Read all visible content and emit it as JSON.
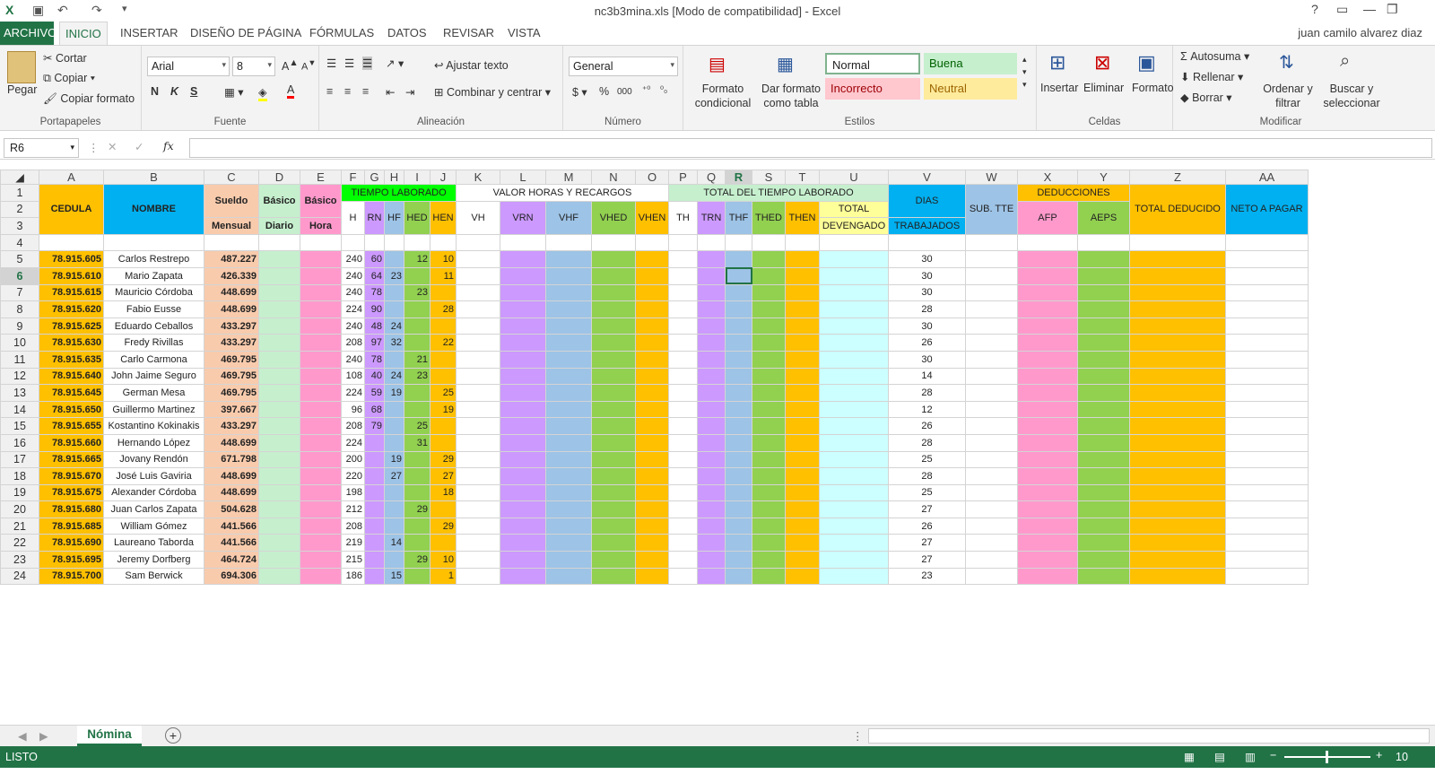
{
  "window": {
    "title": "nc3b3mina.xls  [Modo de compatibilidad] - Excel",
    "help": "?",
    "minimize": "—",
    "restore": "❐",
    "close": "✕"
  },
  "qat": {
    "save": "💾",
    "undo": "↶",
    "redo": "↷",
    "more": "⁼"
  },
  "tabs": [
    "ARCHIVO",
    "INICIO",
    "INSERTAR",
    "DISEÑO DE PÁGINA",
    "FÓRMULAS",
    "DATOS",
    "REVISAR",
    "VISTA"
  ],
  "user": "juan camilo alvarez diaz",
  "ribbon": {
    "clipboard": {
      "label": "Portapapeles",
      "paste": "Pegar",
      "cut": "Cortar",
      "copy": "Copiar",
      "format_painter": "Copiar formato"
    },
    "font": {
      "label": "Fuente",
      "name": "Arial",
      "size": "8",
      "bold": "N",
      "italic": "K",
      "underline": "S"
    },
    "alignment": {
      "label": "Alineación",
      "wrap": "Ajustar texto",
      "merge": "Combinar y centrar"
    },
    "number": {
      "label": "Número",
      "format": "General",
      "currency": "$",
      "percent": "%",
      "thousands": "000"
    },
    "styles": {
      "label": "Estilos",
      "conditional": "Formato condicional",
      "as_table": "Dar formato como tabla",
      "normal": "Normal",
      "good": "Buena",
      "bad": "Incorrecto",
      "neutral": "Neutral"
    },
    "cells": {
      "label": "Celdas",
      "insert": "Insertar",
      "delete": "Eliminar",
      "format": "Formato"
    },
    "editing": {
      "label": "Modificar",
      "autosum": "Autosuma",
      "fill": "Rellenar",
      "clear": "Borrar",
      "sort": "Ordenar y filtrar",
      "find": "Buscar y seleccionar"
    }
  },
  "formula_bar": {
    "name_box": "R6",
    "formula": "",
    "fx": "fx"
  },
  "sheet": {
    "columns": [
      "A",
      "B",
      "C",
      "D",
      "E",
      "F",
      "G",
      "H",
      "I",
      "J",
      "K",
      "L",
      "M",
      "N",
      "O",
      "P",
      "Q",
      "R",
      "S",
      "T",
      "U",
      "V",
      "W",
      "X",
      "Y",
      "Z",
      "AA"
    ],
    "header": {
      "cedula": "CEDULA",
      "nombre": "NOMBRE",
      "sueldo1": "Sueldo",
      "sueldo2": "Mensual",
      "basico_d1": "Básico",
      "basico_d2": "Diario",
      "basico_h1": "Básico",
      "basico_h2": "Hora",
      "tiempo": "TIEMPO LABORADO",
      "valor": "VALOR HORAS Y RECARGOS",
      "total_tiempo": "TOTAL DEL TIEMPO LABORADO",
      "h": "H",
      "rn": "RN",
      "hf": "HF",
      "hed": "HED",
      "hen": "HEN",
      "vh": "VH",
      "vrn": "VRN",
      "vhf": "VHF",
      "vhed": "VHED",
      "vhen": "VHEN",
      "th": "TH",
      "trn": "TRN",
      "thf": "THF",
      "thed": "THED",
      "then": "THEN",
      "total1": "TOTAL",
      "total2": "DEVENGADO",
      "dias1": "DIAS",
      "dias2": "TRABAJADOS",
      "subtte": "SUB. TTE",
      "deducciones": "DEDUCCIONES",
      "afp": "AFP",
      "aeps": "AEPS",
      "total_deducido": "TOTAL DEDUCIDO",
      "neto": "NETO A PAGAR"
    },
    "rows": [
      {
        "cedula": "78.915.605",
        "nombre": "Carlos Restrepo",
        "sueldo": "487.227",
        "h": "240",
        "rn": "60",
        "hf": "",
        "hed": "12",
        "hen": "10",
        "dias": "30"
      },
      {
        "cedula": "78.915.610",
        "nombre": "Mario Zapata",
        "sueldo": "426.339",
        "h": "240",
        "rn": "64",
        "hf": "23",
        "hed": "",
        "hen": "11",
        "dias": "30"
      },
      {
        "cedula": "78.915.615",
        "nombre": "Mauricio Córdoba",
        "sueldo": "448.699",
        "h": "240",
        "rn": "78",
        "hf": "",
        "hed": "23",
        "hen": "",
        "dias": "30"
      },
      {
        "cedula": "78.915.620",
        "nombre": "Fabio  Eusse",
        "sueldo": "448.699",
        "h": "224",
        "rn": "90",
        "hf": "",
        "hed": "",
        "hen": "28",
        "dias": "28"
      },
      {
        "cedula": "78.915.625",
        "nombre": "Eduardo Ceballos",
        "sueldo": "433.297",
        "h": "240",
        "rn": "48",
        "hf": "24",
        "hed": "",
        "hen": "",
        "dias": "30"
      },
      {
        "cedula": "78.915.630",
        "nombre": "Fredy Rivillas",
        "sueldo": "433.297",
        "h": "208",
        "rn": "97",
        "hf": "32",
        "hed": "",
        "hen": "22",
        "dias": "26"
      },
      {
        "cedula": "78.915.635",
        "nombre": "Carlo Carmona",
        "sueldo": "469.795",
        "h": "240",
        "rn": "78",
        "hf": "",
        "hed": "21",
        "hen": "",
        "dias": "30"
      },
      {
        "cedula": "78.915.640",
        "nombre": "John Jaime Seguro",
        "sueldo": "469.795",
        "h": "108",
        "rn": "40",
        "hf": "24",
        "hed": "23",
        "hen": "",
        "dias": "14"
      },
      {
        "cedula": "78.915.645",
        "nombre": "German Mesa",
        "sueldo": "469.795",
        "h": "224",
        "rn": "59",
        "hf": "19",
        "hed": "",
        "hen": "25",
        "dias": "28"
      },
      {
        "cedula": "78.915.650",
        "nombre": "Guillermo Martinez",
        "sueldo": "397.667",
        "h": "96",
        "rn": "68",
        "hf": "",
        "hed": "",
        "hen": "19",
        "dias": "12"
      },
      {
        "cedula": "78.915.655",
        "nombre": "Kostantino Kokinakis",
        "sueldo": "433.297",
        "h": "208",
        "rn": "79",
        "hf": "",
        "hed": "25",
        "hen": "",
        "dias": "26"
      },
      {
        "cedula": "78.915.660",
        "nombre": "Hernando López",
        "sueldo": "448.699",
        "h": "224",
        "rn": "",
        "hf": "",
        "hed": "31",
        "hen": "",
        "dias": "28"
      },
      {
        "cedula": "78.915.665",
        "nombre": "Jovany Rendón",
        "sueldo": "671.798",
        "h": "200",
        "rn": "",
        "hf": "19",
        "hed": "",
        "hen": "29",
        "dias": "25"
      },
      {
        "cedula": "78.915.670",
        "nombre": "José Luis Gaviria",
        "sueldo": "448.699",
        "h": "220",
        "rn": "",
        "hf": "27",
        "hed": "",
        "hen": "27",
        "dias": "28"
      },
      {
        "cedula": "78.915.675",
        "nombre": "Alexander  Córdoba",
        "sueldo": "448.699",
        "h": "198",
        "rn": "",
        "hf": "",
        "hed": "",
        "hen": "18",
        "dias": "25"
      },
      {
        "cedula": "78.915.680",
        "nombre": "Juan Carlos Zapata",
        "sueldo": "504.628",
        "h": "212",
        "rn": "",
        "hf": "",
        "hed": "29",
        "hen": "",
        "dias": "27"
      },
      {
        "cedula": "78.915.685",
        "nombre": "William Gómez",
        "sueldo": "441.566",
        "h": "208",
        "rn": "",
        "hf": "",
        "hed": "",
        "hen": "29",
        "dias": "26"
      },
      {
        "cedula": "78.915.690",
        "nombre": "Laureano Taborda",
        "sueldo": "441.566",
        "h": "219",
        "rn": "",
        "hf": "14",
        "hed": "",
        "hen": "",
        "dias": "27"
      },
      {
        "cedula": "78.915.695",
        "nombre": "Jeremy Dorfberg",
        "sueldo": "464.724",
        "h": "215",
        "rn": "",
        "hf": "",
        "hed": "29",
        "hen": "10",
        "dias": "27"
      },
      {
        "cedula": "78.915.700",
        "nombre": "Sam Berwick",
        "sueldo": "694.306",
        "h": "186",
        "rn": "",
        "hf": "15",
        "hed": "",
        "hen": "1",
        "dias": "23"
      }
    ]
  },
  "sheet_tabs": {
    "active": "Nómina",
    "add": "+"
  },
  "status": {
    "ready": "LISTO",
    "zoom": "10"
  }
}
